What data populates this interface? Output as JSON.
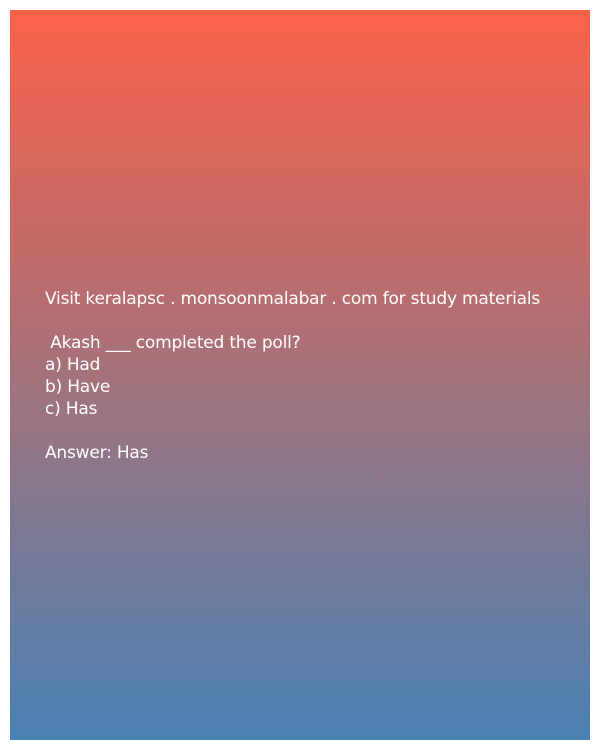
{
  "post": {
    "header": "Visit keralapsc . monsoonmalabar . com for study materials",
    "question": " Akash ___ completed the poll?",
    "options": [
      "a) Had",
      "b) Have",
      "c) Has"
    ],
    "answer": "Answer: Has"
  },
  "colors": {
    "gradient_top": "#fb624b",
    "gradient_bottom": "#4a82b4",
    "text": "#ffffff"
  }
}
